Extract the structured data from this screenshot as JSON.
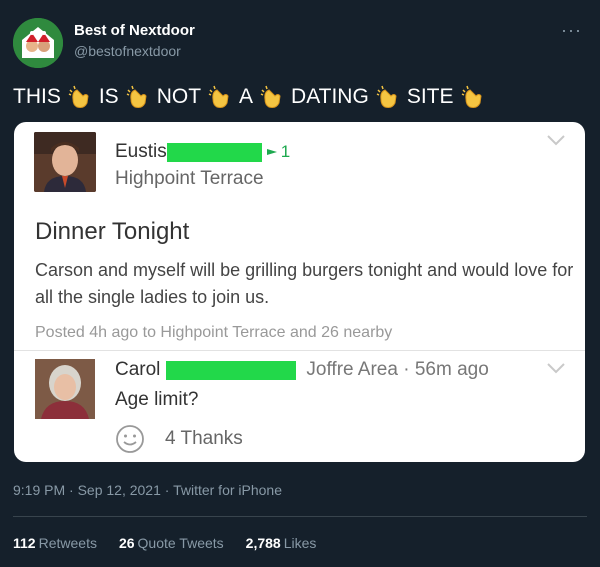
{
  "author": {
    "name": "Best of Nextdoor",
    "handle": "@bestofnextdoor"
  },
  "tweet": {
    "words": [
      "THIS",
      "IS",
      "NOT",
      "A",
      "DATING",
      "SITE"
    ],
    "clap_icon": "clapping-hands-icon"
  },
  "post": {
    "author_name": "Eustis",
    "badge_count": "1",
    "location": "Highpoint Terrace",
    "title": "Dinner Tonight",
    "body": "Carson and myself will be grilling burgers tonight and would love for all the single ladies to join us.",
    "meta": "Posted 4h ago to Highpoint Terrace and 26 nearby"
  },
  "reply": {
    "author_name": "Carol",
    "meta": "Joffre Area · 56m ago",
    "text": "Age limit?",
    "thanks": "4 Thanks"
  },
  "footer": {
    "timestamp": "9:19 PM · Sep 12, 2021 · Twitter for iPhone",
    "retweets_count": "112",
    "retweets_label": "Retweets",
    "quotes_count": "26",
    "quotes_label": "Quote Tweets",
    "likes_count": "2,788",
    "likes_label": "Likes"
  },
  "colors": {
    "background": "#15202b",
    "redaction": "#22d84a",
    "nextdoor_green": "#1ea94f"
  }
}
